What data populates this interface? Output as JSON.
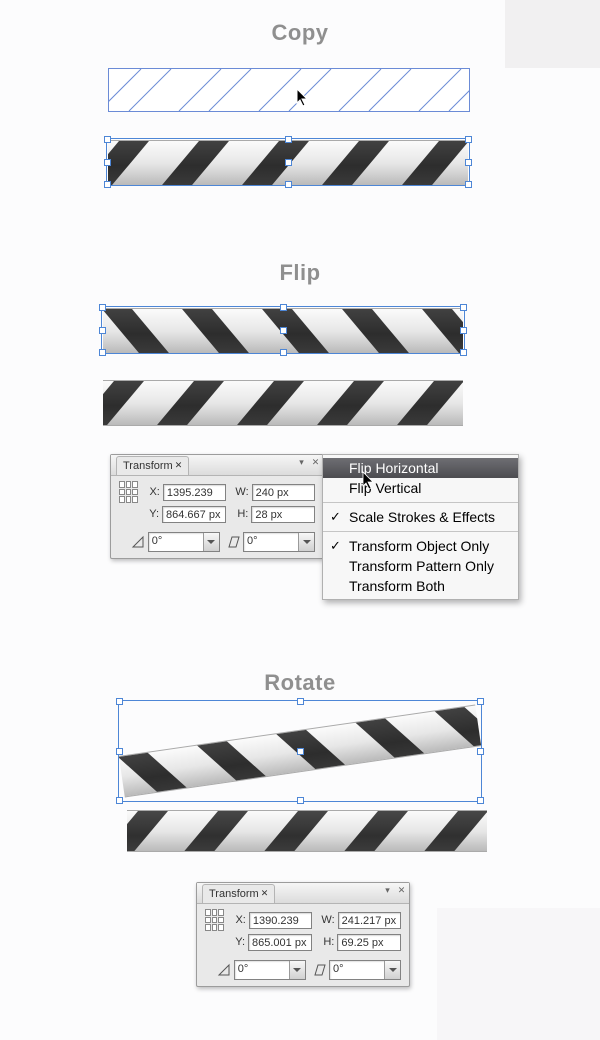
{
  "sections": {
    "copy": {
      "title": "Copy"
    },
    "flip": {
      "title": "Flip"
    },
    "rotate": {
      "title": "Rotate"
    }
  },
  "transform_panel_1": {
    "tab_label": "Transform",
    "x_label": "X:",
    "y_label": "Y:",
    "w_label": "W:",
    "h_label": "H:",
    "x_value": "1395.239 px",
    "y_value": "864.667 px",
    "w_value": "240 px",
    "h_value": "28 px",
    "angle_value": "0°",
    "shear_value": "0°"
  },
  "transform_panel_2": {
    "tab_label": "Transform",
    "x_label": "X:",
    "y_label": "Y:",
    "w_label": "W:",
    "h_label": "H:",
    "x_value": "1390.239 px",
    "y_value": "865.001 px",
    "w_value": "241.217 px",
    "h_value": "69.25 px",
    "angle_value": "0°",
    "shear_value": "0°"
  },
  "menu": {
    "flip_h": "Flip Horizontal",
    "flip_v": "Flip Vertical",
    "scale_strokes": "Scale Strokes & Effects",
    "transform_object": "Transform Object Only",
    "transform_pattern": "Transform Pattern Only",
    "transform_both": "Transform Both"
  }
}
